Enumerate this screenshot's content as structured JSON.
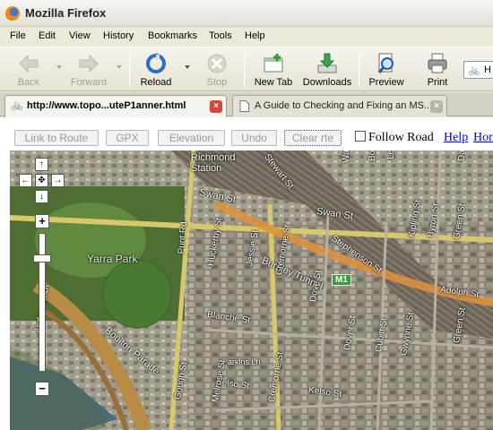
{
  "window": {
    "title": "Mozilla Firefox",
    "icon": "firefox-icon"
  },
  "menu": [
    "File",
    "Edit",
    "View",
    "History",
    "Bookmarks",
    "Tools",
    "Help"
  ],
  "toolbar": {
    "back": "Back",
    "forward": "Forward",
    "reload": "Reload",
    "stop": "Stop",
    "new_tab": "New Tab",
    "downloads": "Downloads",
    "preview": "Preview",
    "print": "Print",
    "url_partial": "H"
  },
  "tabs": [
    {
      "label": "http://www.topo...uteP1anner.html",
      "active": true,
      "icon": "bike-icon"
    },
    {
      "label": "A Guide to Checking and Fixing an MS...",
      "active": false,
      "icon": "document-icon"
    }
  ],
  "page": {
    "buttons": [
      "Link to Route",
      "GPX",
      "Elevation",
      "Undo",
      "Clear rte"
    ],
    "follow_road": "Follow Road",
    "help_link": "Help",
    "home_link": "Hon"
  },
  "map": {
    "pan": {
      "up": "↑",
      "left": "←",
      "center": "✥",
      "right": "→",
      "down": "↓"
    },
    "zoom_in": "+",
    "zoom_out": "−",
    "labels": {
      "richmond_station": "Richmond\nStation",
      "stewart": "Stewart St",
      "wangaratta": "Wangaratta",
      "botherambo": "Botherambo",
      "lennox": "Lennox St",
      "dando": "Dando St",
      "swan_w": "Swan St",
      "swan_e": "Swan St",
      "yarra_park": "Yarra Park",
      "punt": "Punt Rd",
      "burnley": "Burnley Tunnel",
      "stephenson": "Stephenson St",
      "m1": "M1",
      "kipling": "Kipling St",
      "byron": "Byron St",
      "green_n": "Green St",
      "huckerby": "Huckerby St",
      "jessie": "Jessie St",
      "cremorne": "Cremorne St",
      "dove_n": "Dove St",
      "adolph": "Adolph St",
      "blanche": "Blanche St",
      "boulton": "Boulton Parade",
      "anderson": "Anderson St",
      "parkins": "Parkins Ln",
      "dover": "Dover St",
      "cubitt": "Cubitt St",
      "gwynne": "Gwynne St",
      "green_s": "Green St",
      "kelso_w": "Kelso St",
      "kelso_e": "Kelso St",
      "gough": "Gough St",
      "melrose": "Melrose St",
      "cremorne_s": "Cremorne St"
    }
  }
}
